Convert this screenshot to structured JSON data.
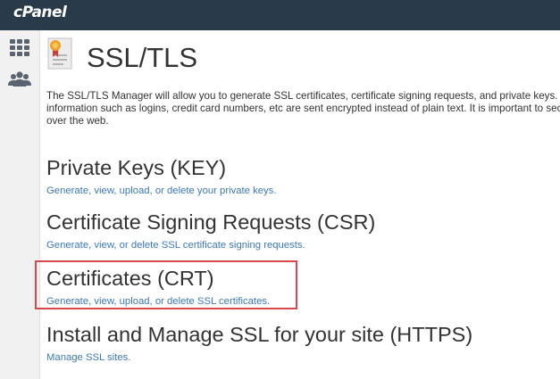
{
  "header": {
    "logo_text": "cPanel"
  },
  "sidebar": {
    "items": [
      {
        "icon": "grid-icon"
      },
      {
        "icon": "users-icon"
      }
    ]
  },
  "page": {
    "icon": "certificate-icon",
    "title": "SSL/TLS",
    "intro_lines": [
      "The SSL/TLS Manager will allow you to generate SSL certificates, certificate signing requests, and private keys. Thes",
      "information such as logins, credit card numbers, etc are sent encrypted instead of plain text. It is important to secu",
      "over the web."
    ]
  },
  "sections": [
    {
      "title": "Private Keys (KEY)",
      "link": "Generate, view, upload, or delete your private keys."
    },
    {
      "title": "Certificate Signing Requests (CSR)",
      "link": "Generate, view, or delete SSL certificate signing requests."
    },
    {
      "title": "Certificates (CRT)",
      "link": "Generate, view, upload, or delete SSL certificates.",
      "highlighted": true
    },
    {
      "title": "Install and Manage SSL for your site (HTTPS)",
      "link": "Manage SSL sites."
    }
  ],
  "colors": {
    "topbar": "#293a4a",
    "link": "#3b78b7",
    "highlight_border": "#d9484c"
  }
}
